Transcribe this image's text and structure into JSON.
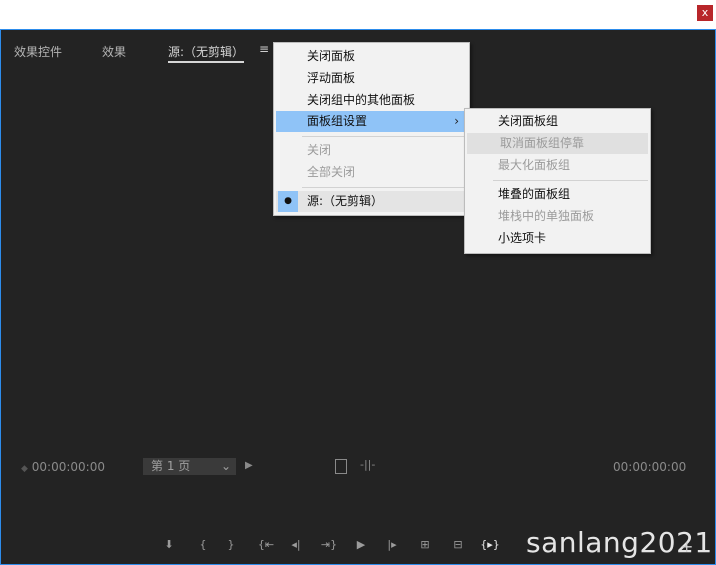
{
  "window": {
    "close_label": "x"
  },
  "tabs": [
    {
      "label": "效果控件"
    },
    {
      "label": "效果"
    },
    {
      "label": "源:（无剪辑）"
    }
  ],
  "tab_menu_icon": "≡",
  "context_menu": {
    "items": [
      {
        "label": "关闭面板"
      },
      {
        "label": "浮动面板"
      },
      {
        "label": "关闭组中的其他面板"
      },
      {
        "label": "面板组设置",
        "arrow": "›"
      },
      {
        "label": "关闭"
      },
      {
        "label": "全部关闭"
      },
      {
        "label": "源:（无剪辑）",
        "bullet": "●"
      }
    ]
  },
  "submenu": {
    "items": [
      {
        "label": "关闭面板组"
      },
      {
        "label": "取消面板组停靠"
      },
      {
        "label": "最大化面板组"
      },
      {
        "label": "堆叠的面板组"
      },
      {
        "label": "堆栈中的单独面板"
      },
      {
        "label": "小选项卡"
      }
    ]
  },
  "monitor": {
    "timecode_left": "00:00:00:00",
    "timecode_right": "00:00:00:00",
    "page_label": "第 1 页"
  },
  "controls": {
    "add_marker": "⬇",
    "mark_in": "{",
    "mark_out": "}",
    "go_in": "{⇤",
    "step_back": "◂|",
    "go_out": "⇥}",
    "play": "▶",
    "step_fwd": "|▸",
    "insert": "⊞",
    "overwrite": "⊟",
    "export_frame": "{▸}"
  },
  "watermark": "sanlang2021",
  "plus": "+"
}
